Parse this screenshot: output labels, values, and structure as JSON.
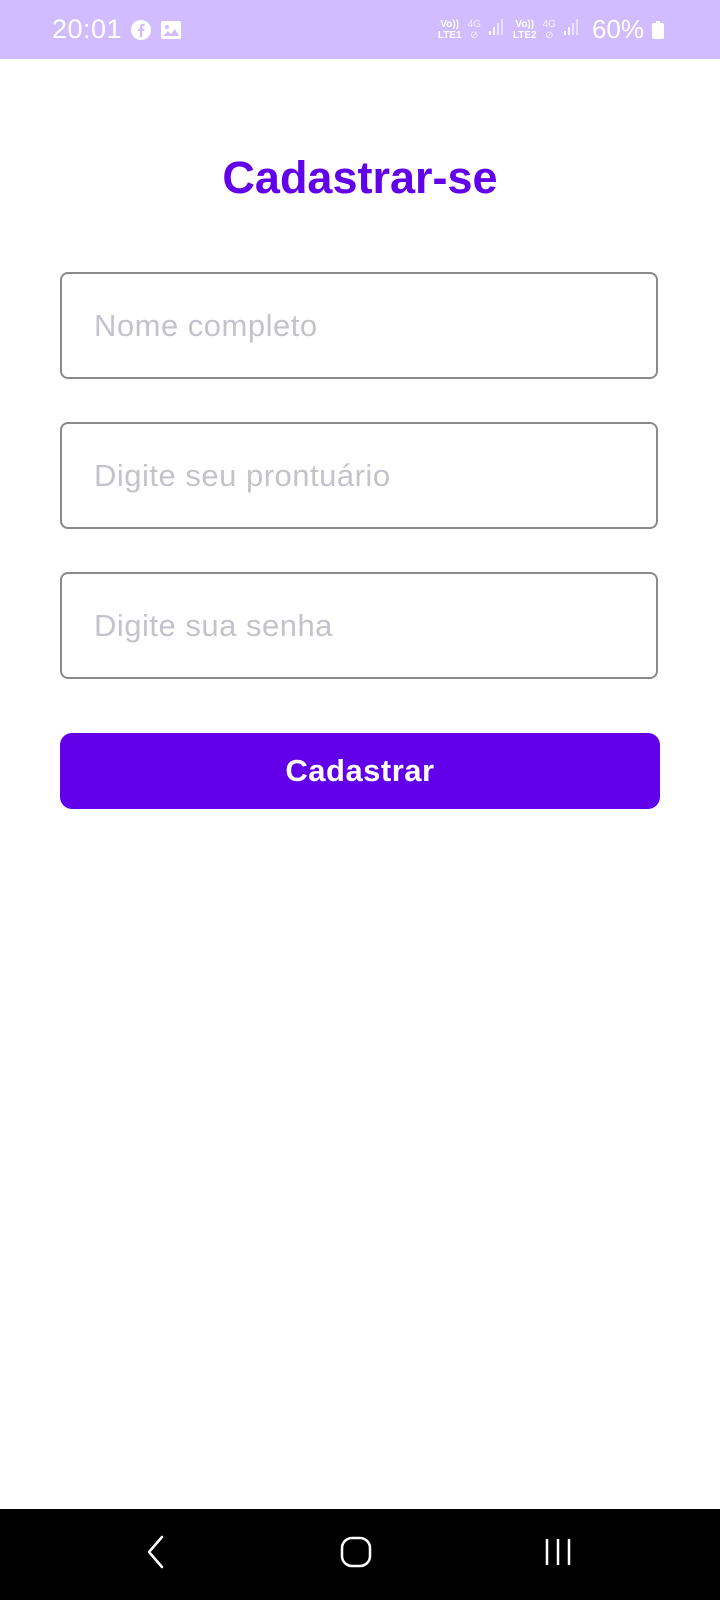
{
  "status_bar": {
    "time": "20:01",
    "sim1_top": "Vo))",
    "sim1_bottom": "LTE1",
    "sim1_net": "4G",
    "sim2_top": "Vo))",
    "sim2_bottom": "LTE2",
    "sim2_net": "4G",
    "battery": "60%",
    "icons": [
      "facebook-icon",
      "gallery-icon",
      "signal-icon",
      "battery-icon"
    ]
  },
  "title": "Cadastrar-se",
  "form": {
    "name_placeholder": "Nome completo",
    "name_value": "",
    "record_placeholder": "Digite seu prontuário",
    "record_value": "",
    "password_placeholder": "Digite sua senha",
    "password_value": "",
    "submit_label": "Cadastrar"
  },
  "colors": {
    "accent": "#6200ea",
    "status_bar": "#d0bcff",
    "placeholder": "#c4c3cc",
    "field_border": "#8a8a8e"
  },
  "nav_bar": {
    "icons": [
      "back-icon",
      "home-icon",
      "recents-icon"
    ]
  }
}
